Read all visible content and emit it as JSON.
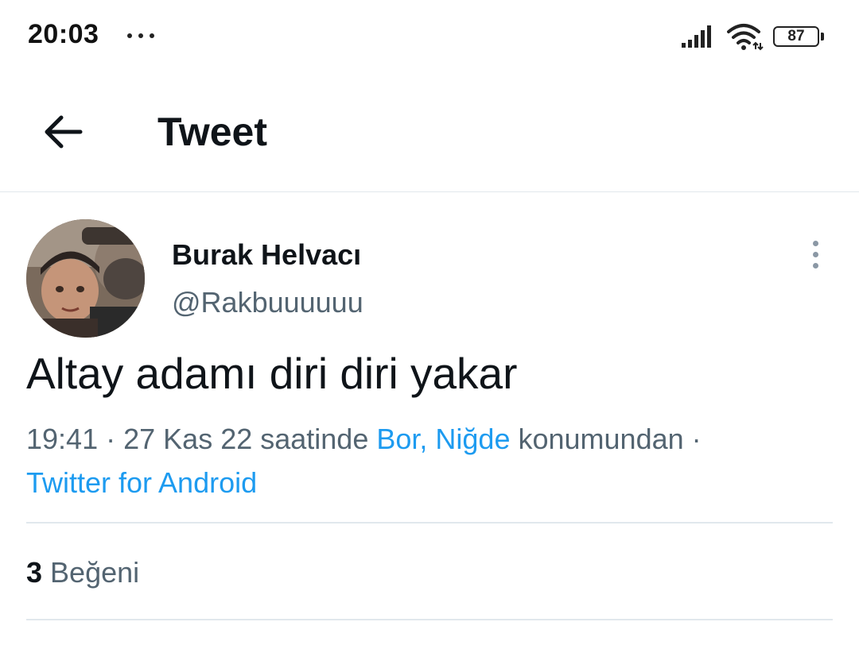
{
  "status_bar": {
    "time": "20:03",
    "battery": "87"
  },
  "header": {
    "title": "Tweet"
  },
  "tweet": {
    "author_name": "Burak Helvacı",
    "author_handle": "@Rakbuuuuuu",
    "text": "Altay adamı diri diri yakar",
    "meta": {
      "time": "19:41",
      "date_phrase": "27 Kas 22 saatinde",
      "location": "Bor, Niğde",
      "location_suffix": "konumundan",
      "source": "Twitter for Android"
    },
    "likes": {
      "count": "3",
      "label": "Beğeni"
    }
  },
  "icons": {
    "back": "arrow-left-icon",
    "more": "vertical-dots-icon",
    "signal": "signal-icon",
    "wifi": "wifi-icon",
    "battery": "battery-icon"
  },
  "colors": {
    "link": "#1d9bf0",
    "secondary_text": "#536471",
    "primary_text": "#0f1419",
    "divider": "#e1e8ed"
  }
}
